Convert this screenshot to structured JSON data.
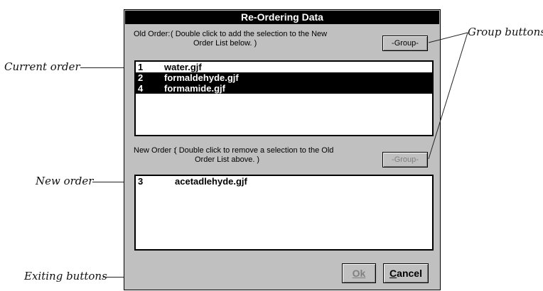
{
  "dialog": {
    "title": "Re-Ordering Data",
    "old_order": {
      "label": "Old Order:",
      "instruction_line1": "( Double click to add the selection to the New",
      "instruction_line2": "Order List below. )",
      "group_button": "-Group-",
      "items": [
        {
          "num": "1",
          "name": "water.gjf",
          "selected": false
        },
        {
          "num": "2",
          "name": "formaldehyde.gjf",
          "selected": true
        },
        {
          "num": "4",
          "name": "formamide.gjf",
          "selected": true
        }
      ]
    },
    "new_order": {
      "label": "New Order :",
      "instruction_line1": "( Double click to remove a selection to the Old",
      "instruction_line2": "Order List above. )",
      "group_button": "-Group-",
      "items": [
        {
          "num": "3",
          "name": "acetadlehyde.gjf"
        }
      ]
    },
    "ok_button": "Ok",
    "cancel_button": "Cancel"
  },
  "annotations": {
    "current_order": "Current order",
    "new_order": "New order",
    "exiting_buttons": "Exiting buttons",
    "group_buttons": "Group buttons"
  }
}
